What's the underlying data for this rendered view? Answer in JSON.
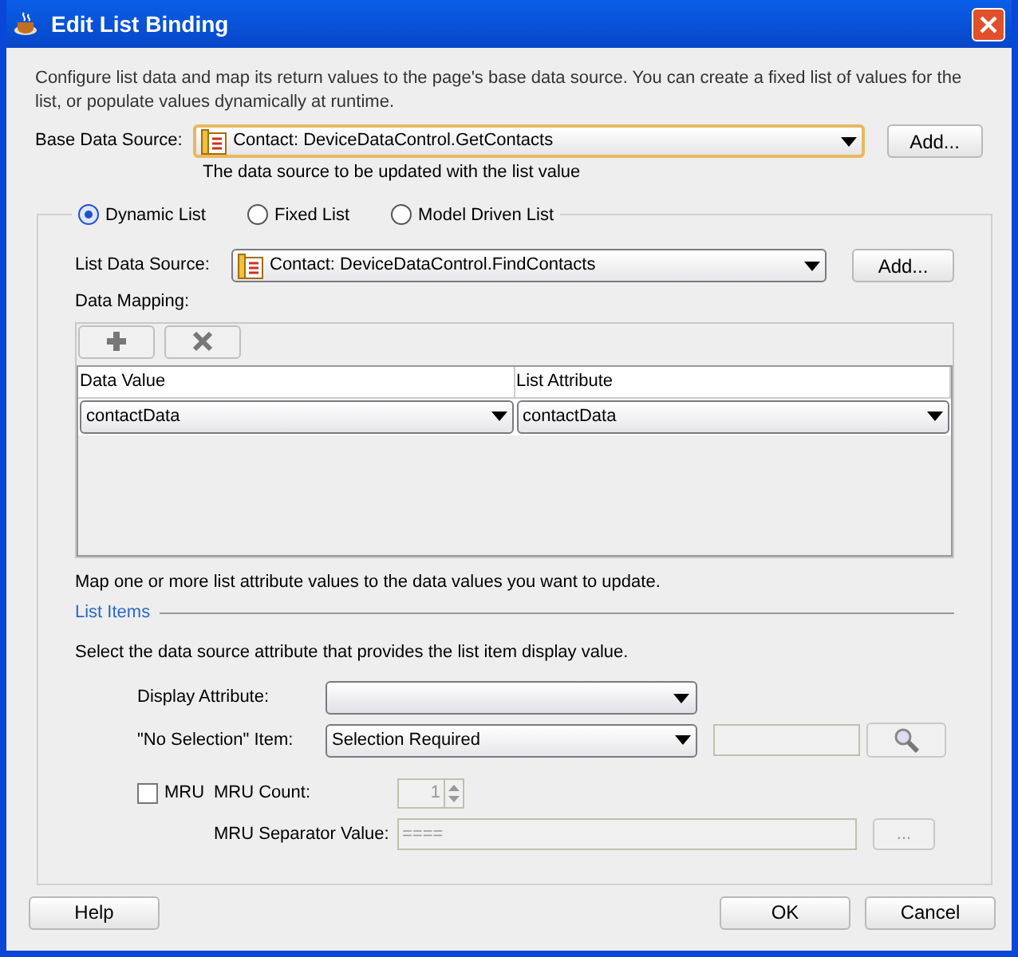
{
  "window": {
    "title": "Edit List Binding"
  },
  "description": "Configure list data and map its return values to the page's base data source. You can create a fixed list of values for the list, or populate values dynamically at runtime.",
  "base_data_source": {
    "label": "Base Data Source:",
    "value": "Contact:  DeviceDataControl.GetContacts",
    "hint": "The data source to be updated with the list value",
    "button": "Add..."
  },
  "list_types": [
    {
      "label": "Dynamic List",
      "selected": true
    },
    {
      "label": "Fixed List",
      "selected": false
    },
    {
      "label": "Model Driven List",
      "selected": false
    }
  ],
  "list_data_source": {
    "label": "List Data Source:",
    "value": "Contact:  DeviceDataControl.FindContacts",
    "button": "Add..."
  },
  "data_mapping": {
    "label": "Data Mapping:",
    "columns": [
      "Data Value",
      "List Attribute"
    ],
    "rows": [
      [
        "contactData",
        "contactData"
      ]
    ],
    "note": "Map one or more list attribute values to the data values you want to update."
  },
  "list_items": {
    "title": "List Items",
    "description": "Select the data source attribute that provides the list item display value.",
    "display_attribute": {
      "label": "Display Attribute:"
    },
    "no_selection": {
      "label": "\"No Selection\" Item:",
      "value": "Selection Required"
    },
    "mru": {
      "label": "MRU",
      "checked": false
    },
    "mru_count": {
      "label": "MRU Count:",
      "value": "1"
    },
    "mru_separator": {
      "label": "MRU Separator Value:",
      "value": "====",
      "button": "..."
    }
  },
  "buttons": {
    "help": "Help",
    "ok": "OK",
    "cancel": "Cancel"
  }
}
